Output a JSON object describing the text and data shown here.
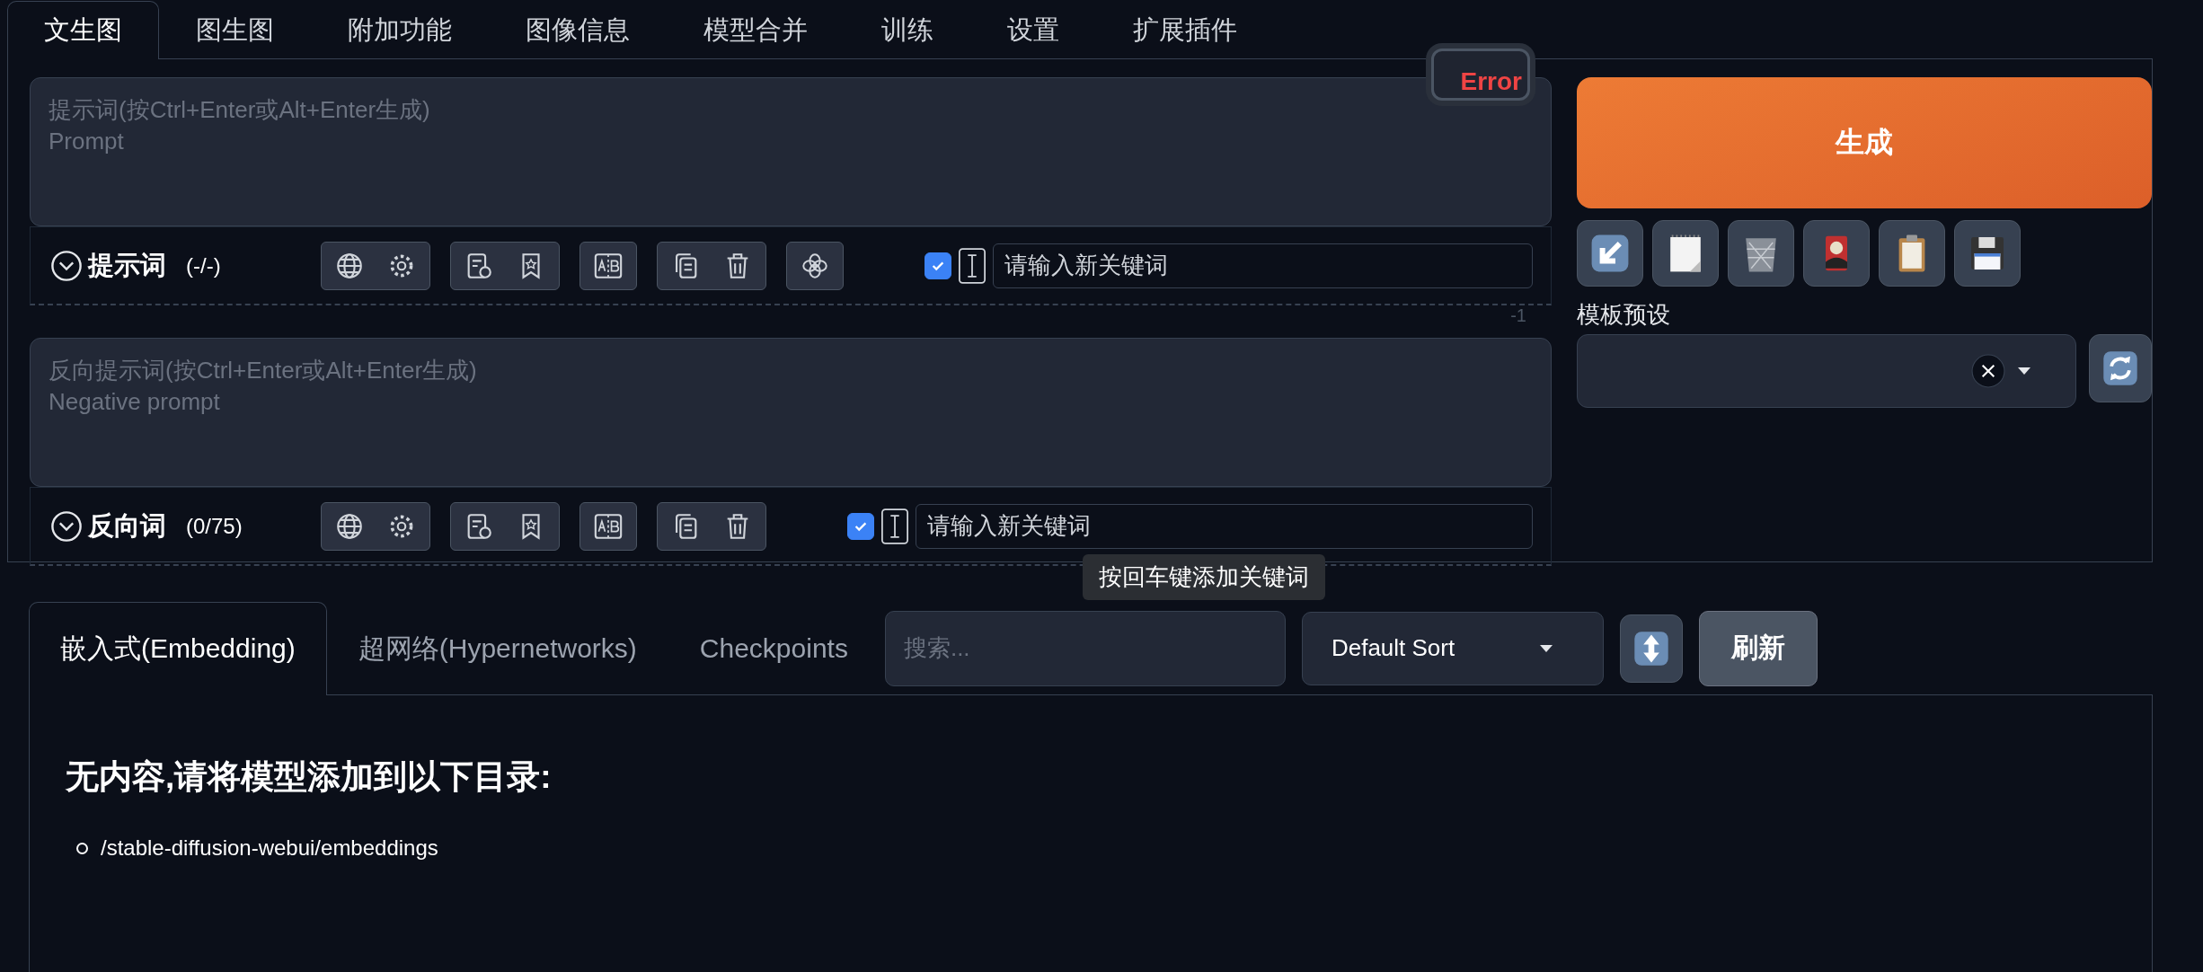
{
  "tabs": [
    {
      "label": "文生图",
      "selected": true
    },
    {
      "label": "图生图",
      "selected": false
    },
    {
      "label": "附加功能",
      "selected": false
    },
    {
      "label": "图像信息",
      "selected": false
    },
    {
      "label": "模型合并",
      "selected": false
    },
    {
      "label": "训练",
      "selected": false
    },
    {
      "label": "设置",
      "selected": false
    },
    {
      "label": "扩展插件",
      "selected": false
    }
  ],
  "error_badge": "Error",
  "prompts": [
    {
      "placeholder": "提示词(按Ctrl+Enter或Alt+Enter生成)\nPrompt",
      "title": "提示词",
      "count": "(-/-)",
      "ai_button": true,
      "keyword_checked": true,
      "keyword_placeholder": "请输入新关键词"
    },
    {
      "placeholder": "反向提示词(按Ctrl+Enter或Alt+Enter生成)\nNegative prompt",
      "counter": "-1",
      "title": "反向词",
      "count": "(0/75)",
      "ai_button": false,
      "keyword_checked": true,
      "keyword_placeholder": "请输入新关键词",
      "tooltip": "按回车键添加关键词"
    }
  ],
  "generate_button": "生成",
  "preset": {
    "label": "模板预设"
  },
  "extra_tabs": [
    {
      "label": "嵌入式(Embedding)",
      "selected": true
    },
    {
      "label": "超网络(Hypernetworks)",
      "selected": false
    },
    {
      "label": "Checkpoints",
      "selected": false
    }
  ],
  "search": {
    "placeholder": "搜索..."
  },
  "sort": {
    "value": "Default Sort"
  },
  "refresh_button": "刷新",
  "empty": {
    "heading": "无内容,请将模型添加到以下目录:",
    "paths": [
      "/stable-diffusion-webui/embeddings"
    ]
  }
}
